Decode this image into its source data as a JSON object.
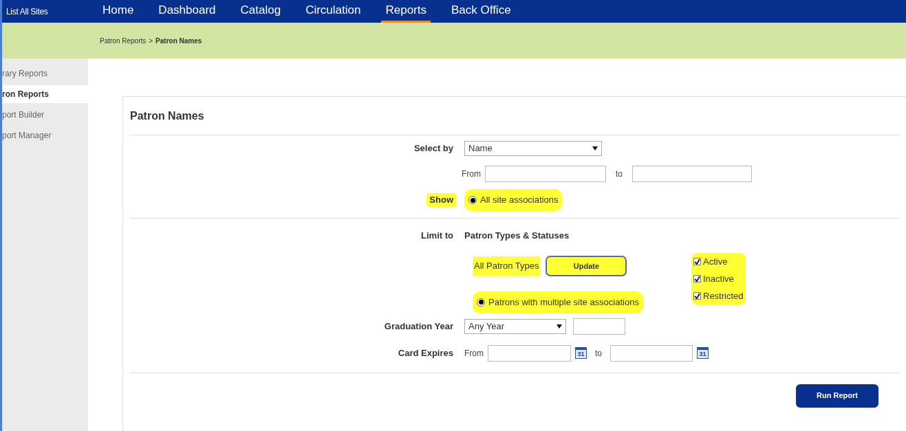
{
  "top_bar": {
    "site_link": "List All Sites",
    "nav": [
      {
        "label": "Home",
        "selected": false
      },
      {
        "label": "Dashboard",
        "selected": false
      },
      {
        "label": "Catalog",
        "selected": false
      },
      {
        "label": "Circulation",
        "selected": false
      },
      {
        "label": "Reports",
        "selected": true
      },
      {
        "label": "Back Office",
        "selected": false
      }
    ]
  },
  "breadcrumb": {
    "parent": "Patron Reports",
    "separator": ">",
    "current": "Patron Names"
  },
  "sidebar": {
    "items": [
      {
        "label": "rary Reports",
        "selected": false
      },
      {
        "label": "ron Reports",
        "selected": true
      },
      {
        "label": "port Builder",
        "selected": false
      },
      {
        "label": "port Manager",
        "selected": false
      }
    ]
  },
  "panel": {
    "title": "Patron Names",
    "select_by": {
      "label": "Select by",
      "value": "Name",
      "from_label": "From",
      "to_label": "to"
    },
    "show": {
      "label": "Show",
      "option": "All site associations",
      "selected": true,
      "highlighted": true
    },
    "limit_to": {
      "label": "Limit to",
      "heading": "Patron Types & Statuses",
      "types_label": "All Patron Types",
      "types_highlighted": true,
      "update_button": "Update",
      "update_highlighted": true,
      "statuses": [
        {
          "label": "Active",
          "checked": true
        },
        {
          "label": "Inactive",
          "checked": true
        },
        {
          "label": "Restricted",
          "checked": true
        }
      ],
      "statuses_highlighted": true,
      "multi_option": "Patrons with multiple site associations",
      "multi_selected": true,
      "multi_highlighted": true
    },
    "graduation_year": {
      "label": "Graduation Year",
      "value": "Any Year"
    },
    "card_expires": {
      "label": "Card Expires",
      "from_label": "From",
      "to_label": "to",
      "from_calendar_text": "31",
      "to_calendar_text": "31"
    },
    "run_button": "Run Report"
  }
}
